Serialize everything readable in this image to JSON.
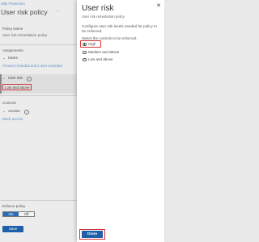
{
  "left_blade": {
    "breadcrumb": "ntity Protection",
    "title": "User risk policy",
    "more_icon": "ellipsis-icon",
    "policy_name_label": "Policy Name",
    "policy_name_value": "User risk remediation policy",
    "assignments_label": "Assignments",
    "users_label": "Users",
    "users_value": "All users included and 1 user excluded",
    "user_risk_label": "User risk",
    "user_risk_value": "Low and above",
    "controls_label": "Controls",
    "access_label": "Access",
    "access_value": "Block access",
    "enforce_label": "Enforce policy",
    "toggle_on": "On",
    "toggle_off": "Off",
    "save_label": "Save"
  },
  "right_blade": {
    "title": "User risk",
    "subtitle": "User risk remediation policy",
    "description": "Configure user risk levels needed for policy to be enforced",
    "select_label": "Select the controls to be enforced.",
    "options": [
      {
        "label": "High",
        "checked": true
      },
      {
        "label": "Medium and above",
        "checked": false
      },
      {
        "label": "Low and above",
        "checked": false
      }
    ],
    "done_label": "Done",
    "close_icon": "close-icon"
  },
  "colors": {
    "accent": "#1d5fa8",
    "highlight": "#d13438",
    "link": "#5a8fc8"
  }
}
